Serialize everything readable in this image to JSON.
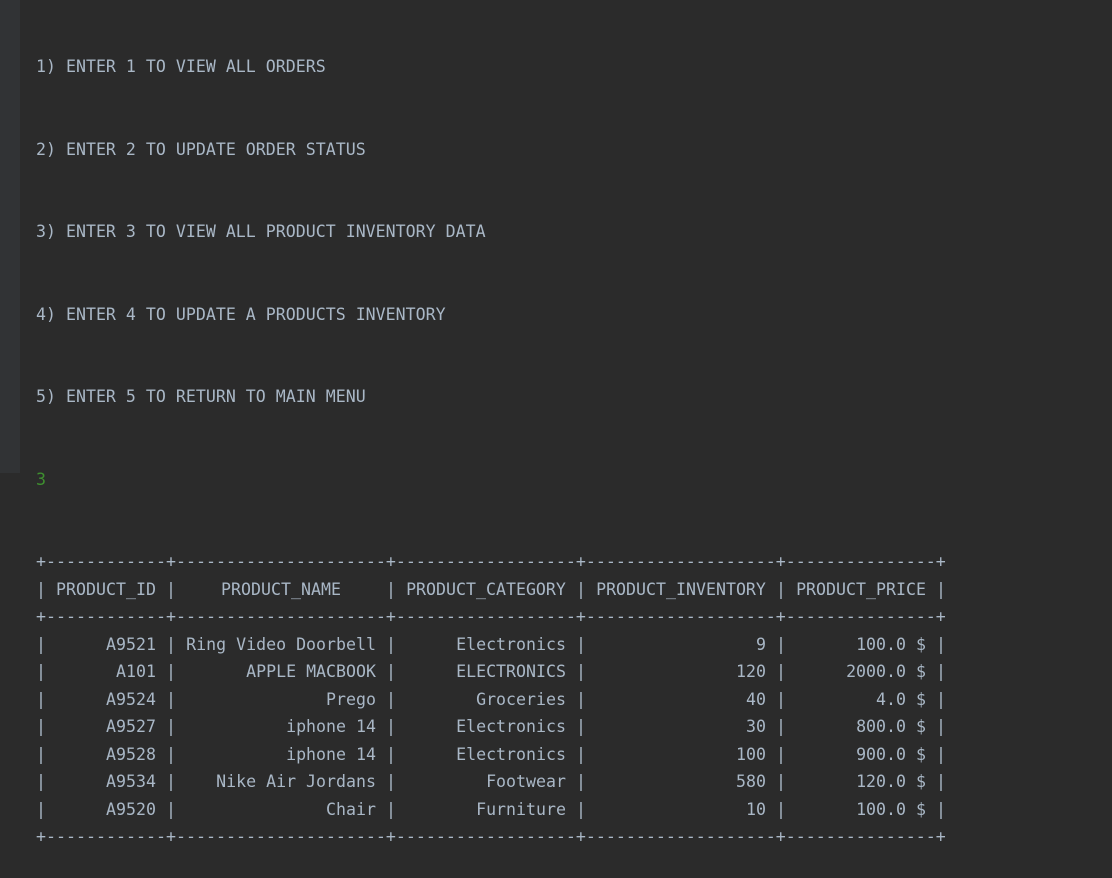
{
  "menu": [
    "1) ENTER 1 TO VIEW ALL ORDERS",
    "2) ENTER 2 TO UPDATE ORDER STATUS",
    "3) ENTER 3 TO VIEW ALL PRODUCT INVENTORY DATA",
    "4) ENTER 4 TO UPDATE A PRODUCTS INVENTORY",
    "5) ENTER 5 TO RETURN TO MAIN MENU"
  ],
  "user_input": "3",
  "table": {
    "headers": [
      "PRODUCT_ID",
      "PRODUCT_NAME",
      "PRODUCT_CATEGORY",
      "PRODUCT_INVENTORY",
      "PRODUCT_PRICE"
    ],
    "rows": [
      [
        "A9521",
        "Ring Video Doorbell",
        "Electronics",
        "9",
        "100.0 $"
      ],
      [
        "A101",
        "APPLE MACBOOK",
        "ELECTRONICS",
        "120",
        "2000.0 $"
      ],
      [
        "A9524",
        "Prego",
        "Groceries",
        "40",
        "4.0 $"
      ],
      [
        "A9527",
        "iphone 14",
        "Electronics",
        "30",
        "800.0 $"
      ],
      [
        "A9528",
        "iphone 14",
        "Electronics",
        "100",
        "900.0 $"
      ],
      [
        "A9534",
        "Nike Air Jordans",
        "Footwear",
        "580",
        "120.0 $"
      ],
      [
        "A9520",
        "Chair",
        "Furniture",
        "10",
        "100.0 $"
      ]
    ]
  },
  "colors": {
    "background": "#2b2b2b",
    "text": "#a9b7c6",
    "input": "#3e8f2f",
    "gutter": "#313335"
  }
}
